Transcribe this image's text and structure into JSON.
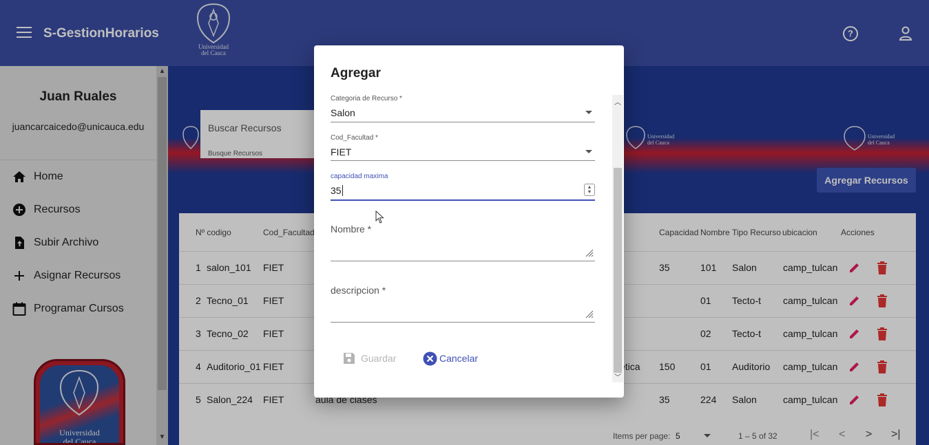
{
  "app": {
    "title": "S-GestionHorarios",
    "logo_text_line1": "Universidad",
    "logo_text_line2": "del Cauca"
  },
  "icons": {
    "menu": "menu-icon",
    "help": "help-icon",
    "account": "user-icon",
    "home": "home-icon",
    "add-circle": "add-circle-icon",
    "upload-file": "upload-file-icon",
    "plus": "plus-icon",
    "calendar": "calendar-icon",
    "edit": "edit-icon",
    "delete": "delete-icon",
    "save": "save-icon",
    "cancel": "cancel-icon"
  },
  "colors": {
    "toolbar": "#3b4ea5",
    "primary": "#3f51b5",
    "accent": "#e91e63",
    "delete": "#e53935"
  },
  "sidebar": {
    "user_name": "Juan Ruales",
    "user_email": "juancarcaicedo@unicauca.edu",
    "items": [
      {
        "label": "Home",
        "icon": "home-icon"
      },
      {
        "label": "Recursos",
        "icon": "add-circle-icon"
      },
      {
        "label": "Subir Archivo",
        "icon": "upload-file-icon"
      },
      {
        "label": "Asignar Recursos",
        "icon": "plus-icon"
      },
      {
        "label": "Programar Cursos",
        "icon": "calendar-icon"
      }
    ],
    "logo_text_line1": "Universidad",
    "logo_text_line2": "del Cauca"
  },
  "main": {
    "search": {
      "value": "Buscar Recursos",
      "hint": "Busque Recursos"
    },
    "banner_logo_line1": "Universidad",
    "banner_logo_line2": "del Cauca",
    "add_button": "Agregar Recursos",
    "table": {
      "headers": [
        "Nº codigo",
        "Cod_Facultad",
        "Capacidad",
        "Nombre",
        "Tipo Recurso",
        "ubicacion",
        "Acciones"
      ],
      "rows": [
        {
          "num": "1",
          "code": "salon_101",
          "facultad": "FIET",
          "desc": "",
          "capacidad": "35",
          "nombre": "101",
          "tipo": "Salon",
          "ubicacion": "camp_tulcan"
        },
        {
          "num": "2",
          "code": "Tecno_01",
          "facultad": "FIET",
          "desc": "",
          "capacidad": "",
          "nombre": "01",
          "tipo": "Tecto-t",
          "ubicacion": "camp_tulcan"
        },
        {
          "num": "3",
          "code": "Tecno_02",
          "facultad": "FIET",
          "desc": "",
          "capacidad": "",
          "nombre": "02",
          "tipo": "Tecto-t",
          "ubicacion": "camp_tulcan"
        },
        {
          "num": "4",
          "code": "Auditorio_01",
          "facultad": "FIET",
          "desc": "ética",
          "capacidad": "150",
          "nombre": "01",
          "tipo": "Auditorio",
          "ubicacion": "camp_tulcan"
        },
        {
          "num": "5",
          "code": "Salon_224",
          "facultad": "FIET",
          "desc": "aula de clases",
          "capacidad": "35",
          "nombre": "224",
          "tipo": "Salon",
          "ubicacion": "camp_tulcan"
        }
      ]
    },
    "paginator": {
      "items_per_page_label": "Items per page:",
      "page_size": "5",
      "range": "1 – 5 of 32",
      "first": "|<",
      "prev": "<",
      "next": ">",
      "last": ">|"
    }
  },
  "dialog": {
    "title": "Agregar",
    "fields": {
      "categoria": {
        "label": "Categoria de Recurso *",
        "value": "Salon"
      },
      "facultad": {
        "label": "Cod_Facultad *",
        "value": "FIET"
      },
      "capacidad": {
        "label": "capacidad maxima",
        "value": "35"
      },
      "nombre": {
        "label": "Nombre *",
        "value": ""
      },
      "descripcion": {
        "label": "descripcion *",
        "value": ""
      }
    },
    "buttons": {
      "save": "Guardar",
      "cancel": "Cancelar"
    }
  }
}
